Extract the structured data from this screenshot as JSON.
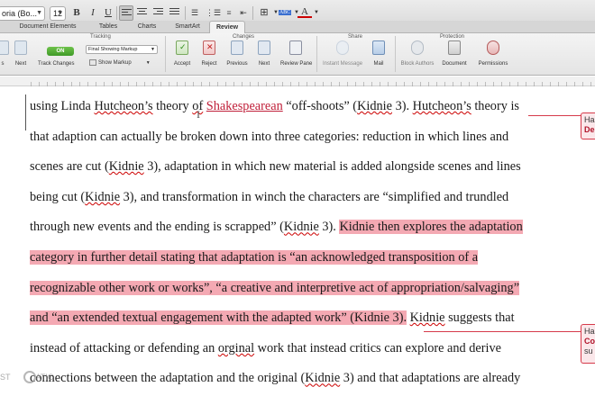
{
  "format_bar": {
    "font_name": "oria (Bo...",
    "font_size": "12",
    "bold": "B",
    "italic": "I",
    "underline": "U",
    "strike": "ABC",
    "color_letter": "A"
  },
  "ribbon_tabs": [
    {
      "label": "Document Elements"
    },
    {
      "label": "Tables"
    },
    {
      "label": "Charts"
    },
    {
      "label": "SmartArt"
    },
    {
      "label": "Review"
    }
  ],
  "ribbon": {
    "groups": {
      "tracking": "Tracking",
      "changes": "Changes",
      "share": "Share",
      "protection": "Protection"
    },
    "toggle_label": "ON",
    "track_changes_label": "Track Changes",
    "markup_select": "Final Showing Markup",
    "show_markup_label": "Show Markup",
    "prev_label": "s",
    "next_left_label": "Next",
    "buttons": {
      "accept": "Accept",
      "reject": "Reject",
      "previous": "Previous",
      "next": "Next",
      "review_pane": "Review Pane",
      "instant_message": "Instant Message",
      "mail": "Mail",
      "block_authors": "Block Authors",
      "document": "Document",
      "permissions": "Permissions"
    }
  },
  "document": {
    "lines": [
      {
        "parts": [
          {
            "t": "using Linda "
          },
          {
            "t": "Hutcheon’s",
            "cls": "cite"
          },
          {
            "t": " theory "
          },
          {
            "t": "of",
            "cls": "cite"
          },
          {
            "t": " "
          },
          {
            "t": "Shakespearean",
            "cls": "del"
          },
          {
            "t": " “off-shoots” ("
          },
          {
            "t": "Kidnie",
            "cls": "cite"
          },
          {
            "t": " 3). "
          },
          {
            "t": "Hutcheon’s",
            "cls": "cite"
          },
          {
            "t": " theory is"
          }
        ]
      },
      {
        "parts": [
          {
            "t": "that adaption can actually be broken down into three categories: reduction in which lines and"
          }
        ]
      },
      {
        "parts": [
          {
            "t": "scenes are cut ("
          },
          {
            "t": "Kidnie",
            "cls": "cite"
          },
          {
            "t": " 3), adaptation in which new material is added alongside scenes and lines"
          }
        ]
      },
      {
        "parts": [
          {
            "t": "being cut ("
          },
          {
            "t": "Kidnie",
            "cls": "cite"
          },
          {
            "t": " 3), and transformation in winch the characters are “simplified and trundled"
          }
        ]
      },
      {
        "parts": [
          {
            "t": "through new events and the ending is scrapped” ("
          },
          {
            "t": "Kidnie",
            "cls": "cite"
          },
          {
            "t": " 3). "
          },
          {
            "t": "Kidnie then explores the adaptation",
            "cls": "hl"
          }
        ]
      },
      {
        "parts": [
          {
            "t": "category in further detail stating that adaptation is “an acknowledged transposition of a",
            "cls": "hl"
          }
        ]
      },
      {
        "parts": [
          {
            "t": "recognizable other work or works”, “a creative and interpretive act of appropriation/salvaging”",
            "cls": "hl"
          }
        ]
      },
      {
        "parts": [
          {
            "t": "and “an extended textual engagement with the adapted work” (Kidnie 3).",
            "cls": "hl"
          },
          {
            "t": " "
          },
          {
            "t": "Kidnie",
            "cls": "cite"
          },
          {
            "t": " suggests that"
          }
        ]
      },
      {
        "parts": [
          {
            "t": "instead of attacking or defending an "
          },
          {
            "t": "orginal",
            "cls": "cite"
          },
          {
            "t": " work that instead critics can explore and derive"
          }
        ]
      },
      {
        "parts": [
          {
            "t": "connections between the adaptation and the original ("
          },
          {
            "t": "Kidnie",
            "cls": "cite"
          },
          {
            "t": " 3) and that adaptations are already"
          }
        ]
      }
    ]
  },
  "comments": [
    {
      "line1": "Ha",
      "line2": "De"
    },
    {
      "line1": "Ha",
      "line2": "Co",
      "line3": "su"
    }
  ],
  "watermark": {
    "left": "ST",
    "right": "ATIC"
  }
}
